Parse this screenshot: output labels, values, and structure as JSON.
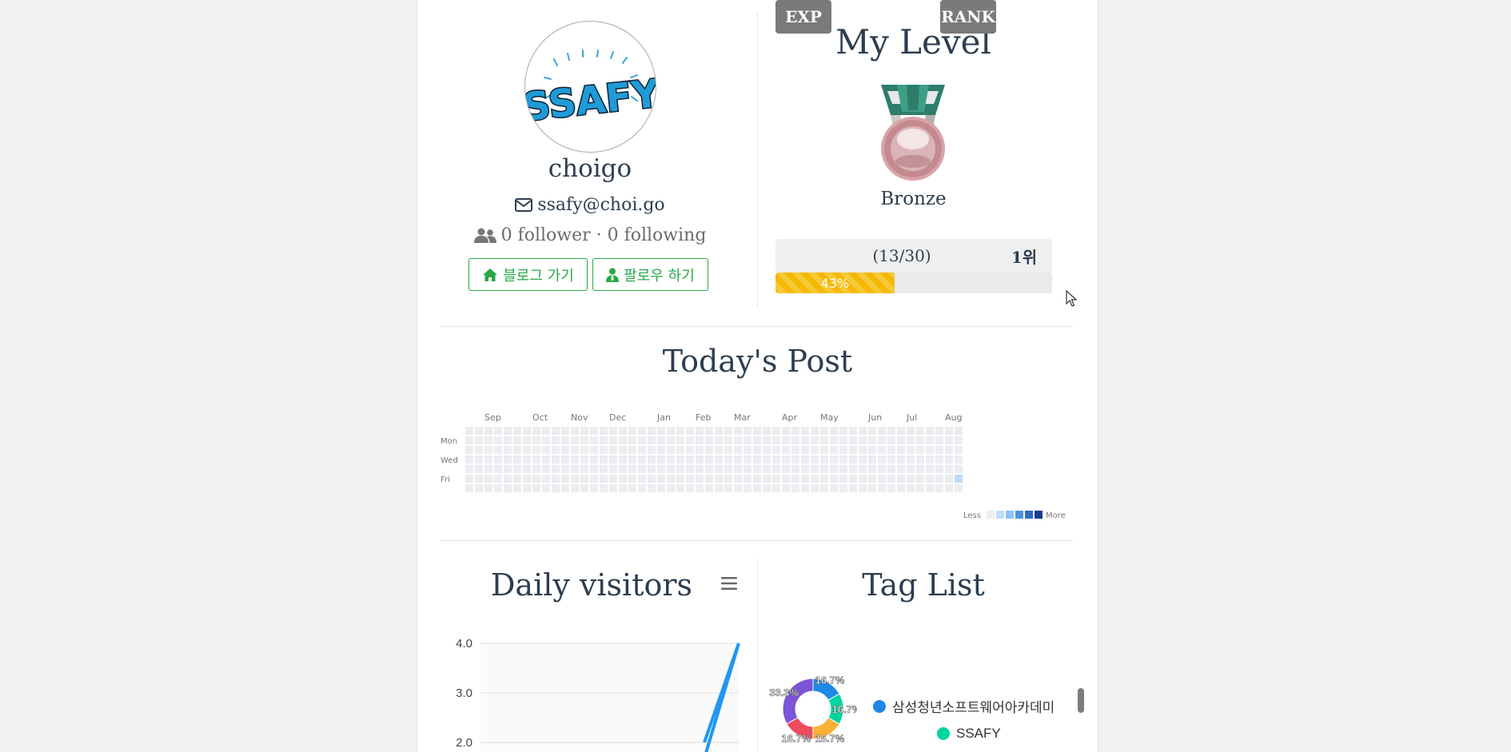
{
  "profile": {
    "username": "choigo",
    "email": "ssafy@choi.go",
    "follow_text": "0 follower · 0 following",
    "blog_button": "블로그 가기",
    "follow_button": "팔로우 하기",
    "logo_text": "SSAFY"
  },
  "level": {
    "title": "My Level",
    "tier": "Bronze",
    "exp_label": "EXP",
    "exp_value": "(13/30)",
    "rank_label": "RANK",
    "rank_value": "1위",
    "progress_text": "43%",
    "progress": 0.43
  },
  "todays_post": {
    "title": "Today's Post",
    "months": [
      "Sep",
      "Oct",
      "Nov",
      "Dec",
      "Jan",
      "Feb",
      "Mar",
      "Apr",
      "May",
      "Jun",
      "Jul",
      "Aug"
    ],
    "days": [
      "Mon",
      "Wed",
      "Fri"
    ],
    "legend_less": "Less",
    "legend_more": "More",
    "active_cells": [
      {
        "week": 51,
        "day": 5,
        "level": 1
      }
    ]
  },
  "daily_visitors": {
    "title": "Daily visitors"
  },
  "tag_list": {
    "title": "Tag List",
    "legend": [
      {
        "label": "삼성청년소프트웨어아카데미",
        "color": "#1e88e5"
      },
      {
        "label": "SSAFY",
        "color": "#00d4a0"
      }
    ]
  },
  "chart_data": [
    {
      "type": "line",
      "title": "Daily visitors",
      "ylim": [
        2.0,
        4.0
      ],
      "yticks": [
        "4.0",
        "3.0",
        "2.0"
      ],
      "series": [
        {
          "values": [
            2.0,
            4.0
          ]
        }
      ],
      "grid": true,
      "color": "#2196f3"
    },
    {
      "type": "pie",
      "title": "Tag List",
      "slices": [
        {
          "value": 16.7,
          "label": "16.7%",
          "color": "#1e88e5"
        },
        {
          "value": 16.7,
          "label": "16.7%",
          "color": "#00d4a0"
        },
        {
          "value": 16.7,
          "label": "16.7%",
          "color": "#f9b233"
        },
        {
          "value": 16.7,
          "label": "16.7%",
          "color": "#ef4b5e"
        },
        {
          "value": 33.3,
          "label": "33.3%",
          "color": "#7b55d6"
        }
      ]
    }
  ]
}
